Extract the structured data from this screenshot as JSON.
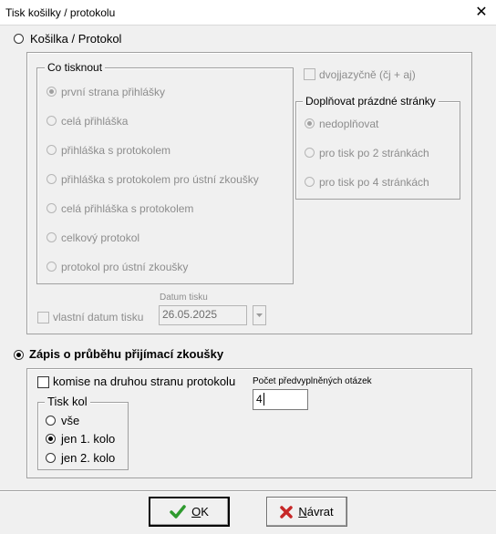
{
  "window": {
    "title": "Tisk košilky / protokolu",
    "close_glyph": "✕"
  },
  "kosilka": {
    "label": "Košilka / Protokol",
    "co_tisknout": {
      "legend": "Co tisknout",
      "options": [
        "první strana přihlášky",
        "celá přihláška",
        "přihláška s protokolem",
        "přihláška s protokolem pro ústní zkoušky",
        "celá přihláška s protokolem",
        "celkový protokol",
        "protokol pro ústní zkoušky"
      ]
    },
    "dvojjazycne": "dvojjazyčně (čj + aj)",
    "doplnovat": {
      "legend": "Doplňovat prázdné stránky",
      "options": [
        "nedoplňovat",
        "pro tisk po 2 stránkách",
        "pro tisk po 4 stránkách"
      ]
    },
    "vlastni_datum": "vlastní datum tisku",
    "datum_tisku_label": "Datum tisku",
    "datum_tisku_value": "26.05.2025"
  },
  "zapis": {
    "label": "Zápis o průběhu přijímací zkoušky",
    "komise": "komise na druhou stranu protokolu",
    "pocet_label": "Počet předvyplněných otázek",
    "pocet_value": "4",
    "tisk_kol": {
      "legend": "Tisk kol",
      "options": [
        "vše",
        "jen 1. kolo",
        "jen 2. kolo"
      ]
    }
  },
  "buttons": {
    "ok_prefix": "",
    "ok_underlined": "O",
    "ok_rest": "K",
    "cancel_underlined": "N",
    "cancel_rest": "ávrat"
  },
  "colors": {
    "ok_icon": "#2e9a2e",
    "cancel_icon": "#c62828"
  }
}
